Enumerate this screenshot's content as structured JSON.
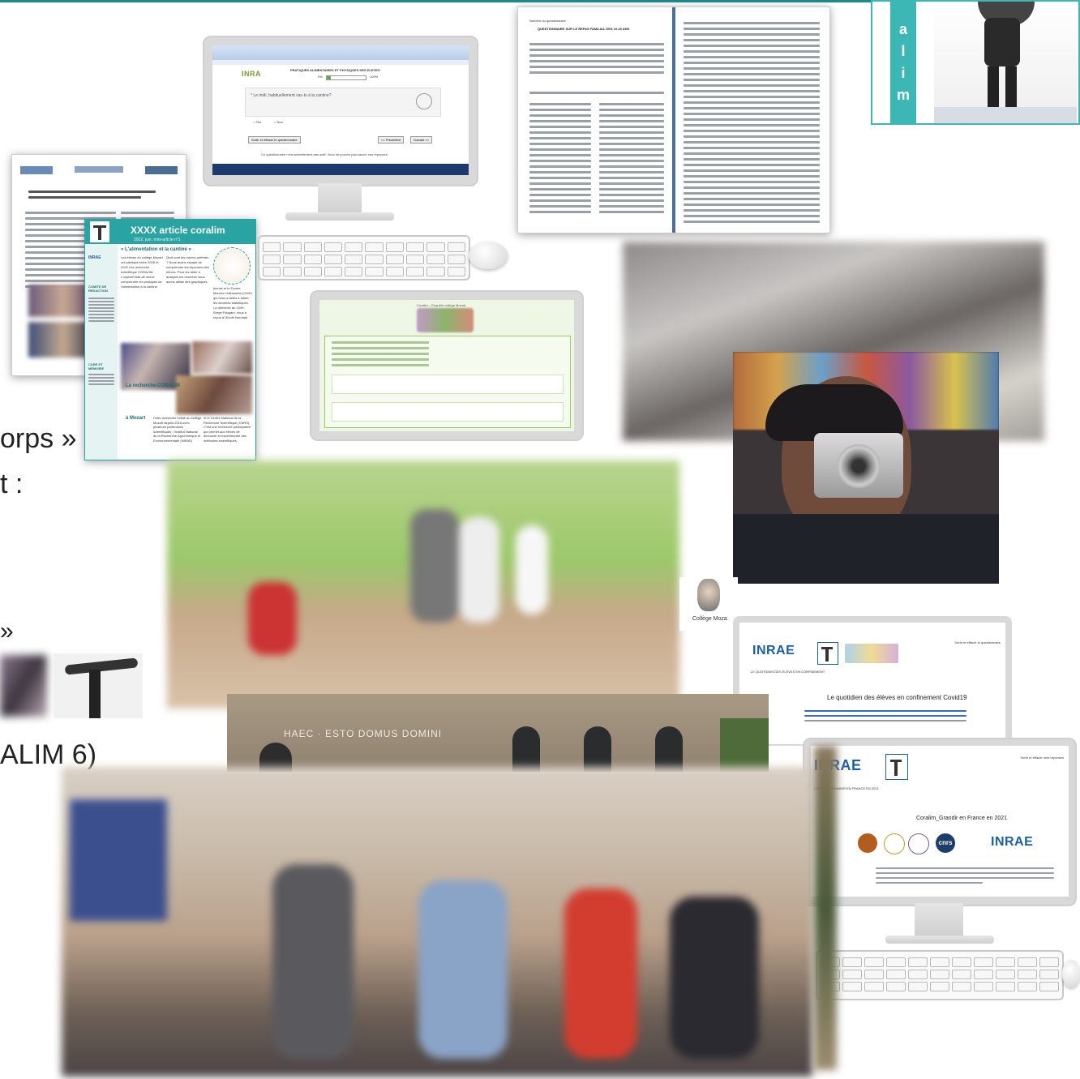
{
  "bg_text": {
    "line1": "orps »",
    "line2": "t :",
    "line3": "»",
    "line4": "ALIM 6)"
  },
  "side_banner": {
    "letters": [
      "a",
      "l",
      "i",
      "m"
    ]
  },
  "monitor1": {
    "logo": "INRA",
    "survey_title": "PRATIQUES ALIMENTAIRES ET PHYSIQUES DES ELEVES",
    "progress_start": "0%",
    "progress_end": "100%",
    "progress_value": 0.1,
    "question": "* Le midi, habituellement vas-tu à la cantine?",
    "option_yes": "Oui",
    "option_no": "Non",
    "btn_exit": "Sortir et effacer le questionnaire",
    "btn_prev": "<< Précédent",
    "btn_next": "Suivant >>",
    "footer_note": "Ce questionnaire n'est actuellement pas actif. Vous ne pouvez pas sauver vos réponses."
  },
  "questionnaire": {
    "left_header": "Numéro du questionnaire :",
    "left_title": "QUESTIONNAIRE SUR LE REPAS FAMILIAL DES 10-15 ANS"
  },
  "newsletter": {
    "title": "XXXX article coralim",
    "subtitle": "2022, juin, mini-article n°1",
    "heading": "« L'alimentation et la cantine »",
    "section": "La recherche CORALIM",
    "location": "à Mozart",
    "sidebar_title": "COMITE DE REDACTION",
    "sidebar2_title": "CARE ET MEMOIRE",
    "body_left": "Les élèves du collège Mozart ont participé entre 2018 et 2022 à la recherche scientifique CORALIM. L'objectif était de mieux comprendre les pratiques de l'alimentation à la cantine.",
    "body_mid": "Quel sont les menus préférés ? Nous avons essayé de comprendre les réponses des élèves. Pour les aider à analyser les données nous avons utilisé des graphiques.",
    "body_right": "jeunes et le Centre Maurice Halbwachs (CMH) qui nous a aidés à traiter les données statistiques. La directrice du CMH, Serge Paugam, nous a reçus à l'Ecole Normale.",
    "body_bottom_left": "Cette recherche existe au collège Mozart depuis 2018 avec plusieurs partenaires scientifiques : l'Institut National de la Recherche Agronomique et Environnementale (INRAE)",
    "body_bottom_right": "et le Centre National de la Recherche Scientifique (CNRS). C'est une recherche participative qui permet aux élèves de découvrir et expérimenter des méthodes scientifiques."
  },
  "monitor2": {
    "title": "Coralim – Enquête collège Mozart"
  },
  "college_label": "Collège Moza",
  "monitor3": {
    "logo": "INRAE",
    "subtitle": "LE QUOTIDIEN DES ÉLÈVES EN CONFINEMENT",
    "headline": "Le quotidien des élèves en confinement Covid19",
    "corner": "Sortir et effacer le questionnaire"
  },
  "monitor4": {
    "logo": "INRAE",
    "subtitle": "CORALIM_GRANDIR EN FRANCE EN 2021",
    "headline": "Coralim_Grandir en France en 2021",
    "corner": "Sortir et effacer mes réponses",
    "partner_logo": "INRAE",
    "cnrs": "cnrs"
  },
  "building": {
    "inscription": "HAEC · ESTO DOMUS DOMINI"
  },
  "colors": {
    "teal": "#2aa3a3",
    "banner_teal": "#3db6b6",
    "inrae_blue": "#1d5fa6",
    "gallery_green": "#9cc86a"
  }
}
